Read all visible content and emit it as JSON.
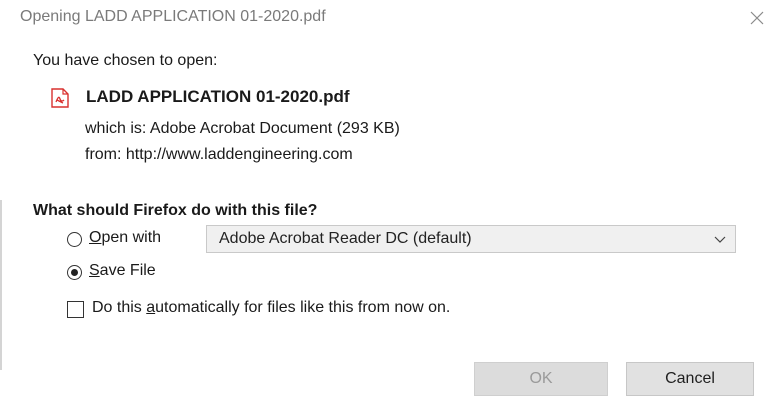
{
  "window": {
    "title": "Opening LADD APPLICATION 01-2020.pdf",
    "close_icon": "close-icon"
  },
  "intro": "You have chosen to open:",
  "file": {
    "icon": "pdf-file-icon",
    "name": "LADD APPLICATION 01-2020.pdf",
    "type_line": "which is: Adobe Acrobat Document (293 KB)",
    "from_line": "from: http://www.laddengineering.com"
  },
  "question": "What should Firefox do with this file?",
  "options": {
    "open_with": {
      "accesskey": "O",
      "rest": "pen with",
      "checked": false
    },
    "app_select": {
      "value": "Adobe Acrobat Reader DC (default)",
      "icon": "chevron-down-icon"
    },
    "save_file": {
      "accesskey": "S",
      "rest": "ave File",
      "checked": true
    },
    "auto": {
      "before": "Do this ",
      "accesskey": "a",
      "after": "utomatically for files like this from now on.",
      "checked": false
    }
  },
  "buttons": {
    "ok": "OK",
    "cancel": "Cancel"
  },
  "colors": {
    "pdf_red": "#d9312f",
    "title_gray": "#7a7a7a"
  }
}
